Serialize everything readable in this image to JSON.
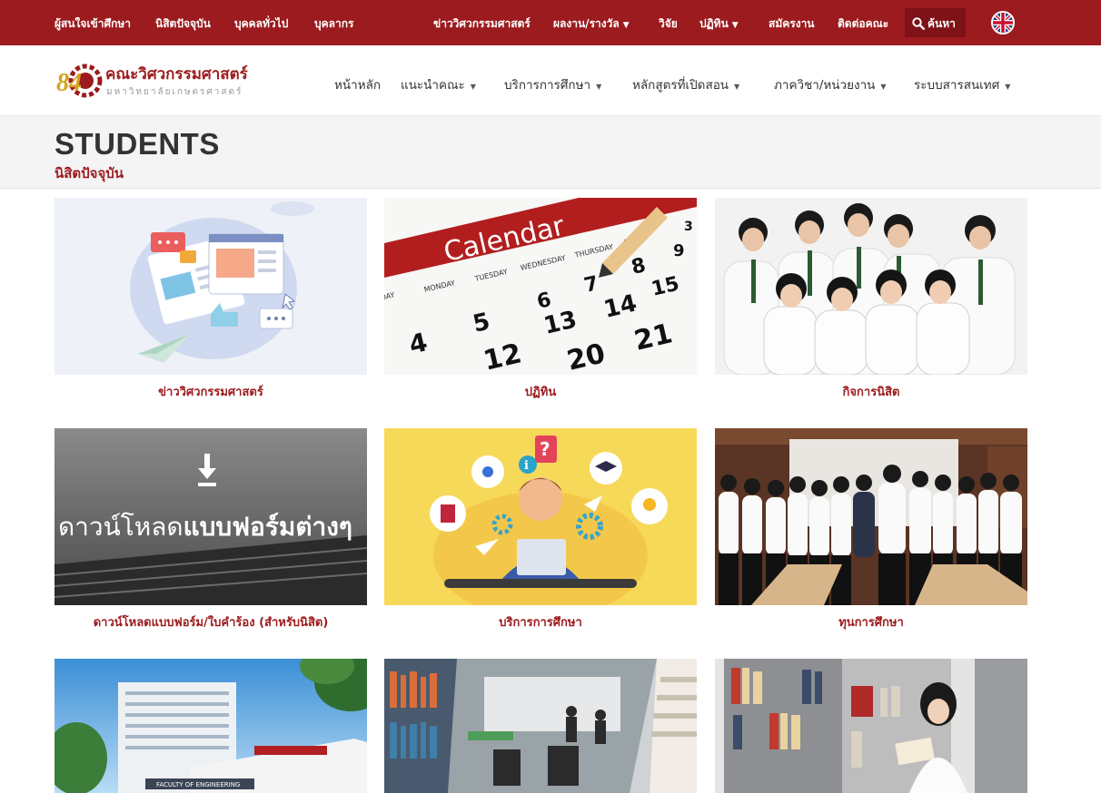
{
  "topbar": {
    "items": [
      "ผู้สนใจเข้าศึกษา",
      "นิสิตปัจจุบัน",
      "บุคคลทั่วไป",
      "บุคลากร",
      "ข่าววิศวกรรมศาสตร์",
      "ผลงาน/รางวัล",
      "วิจัย",
      "ปฏิทิน",
      "สมัครงาน",
      "ติดต่อคณะ"
    ],
    "search_label": "ค้นหา",
    "bg_color": "#9c1b1e"
  },
  "header": {
    "logo_number": "84",
    "logo_title": "คณะวิศวกรรมศาสตร์",
    "logo_subtitle": "มหาวิทยาลัยเกษตรศาสตร์",
    "nav": [
      "หน้าหลัก",
      "แนะนำคณะ",
      "บริการการศึกษา",
      "หลักสูตรที่เปิดสอน",
      "ภาควิชา/หน่วยงาน",
      "ระบบสารสนเทศ"
    ]
  },
  "page": {
    "title": "STUDENTS",
    "subtitle": "นิสิตปัจจุบัน"
  },
  "cards": [
    {
      "label": "ข่าววิศวกรรมศาสตร์"
    },
    {
      "label": "ปฏิทิน",
      "image_text": "Calendar",
      "weekdays": [
        "DAY",
        "MONDAY",
        "TUESDAY",
        "WEDNESDAY",
        "THURSDAY",
        "FR"
      ],
      "numbers": [
        "3",
        "9",
        "6",
        "7",
        "8",
        "15",
        "5",
        "13",
        "14",
        "4",
        "12",
        "20",
        "21"
      ]
    },
    {
      "label": "กิจการนิสิต"
    },
    {
      "label": "ดาวน์โหลดแบบฟอร์ม/ใบคำร้อง (สำหรับนิสิต)",
      "image_text_light": "ดาวน์โหลด",
      "image_text_bold": "แบบฟอร์มต่างๆ"
    },
    {
      "label": "บริการการศึกษา"
    },
    {
      "label": "ทุนการศึกษา"
    },
    {
      "label": "",
      "image_text": "FACULTY OF ENGINEERING"
    },
    {
      "label": ""
    },
    {
      "label": ""
    }
  ]
}
